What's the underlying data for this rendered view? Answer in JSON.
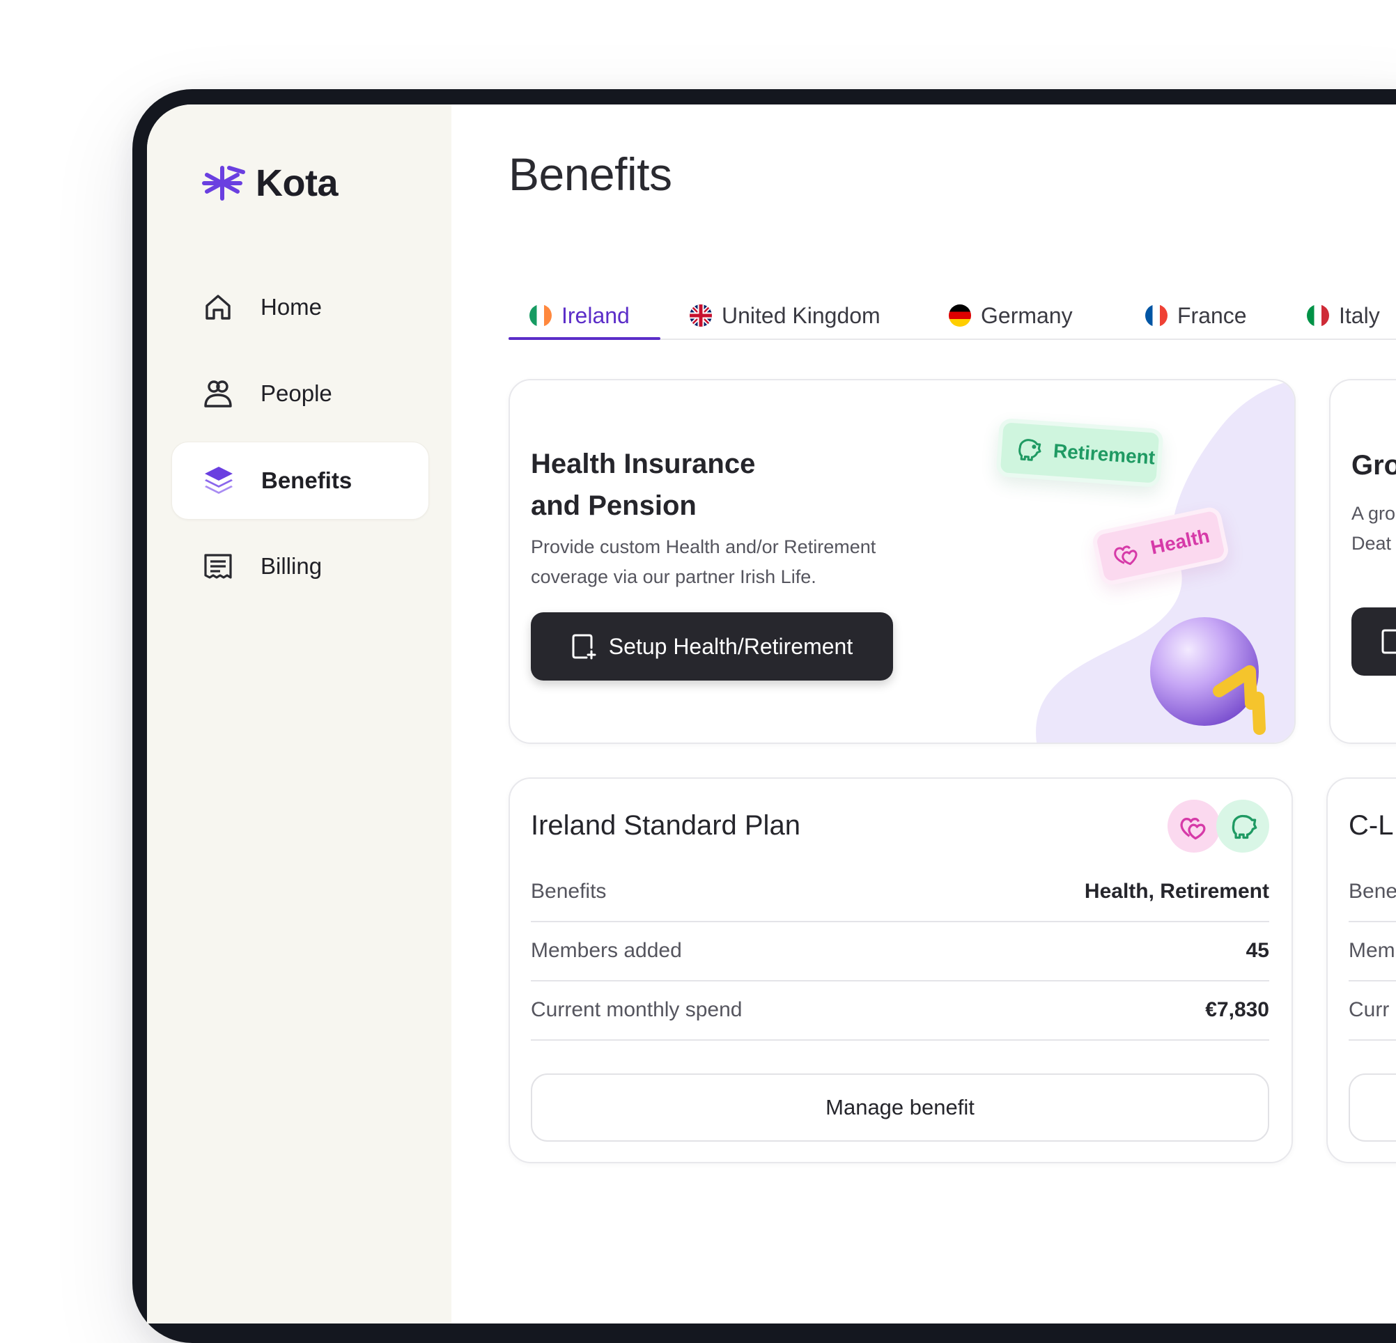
{
  "app": {
    "name": "Kota"
  },
  "nav": [
    {
      "label": "Home",
      "icon": "home-icon"
    },
    {
      "label": "People",
      "icon": "people-icon"
    },
    {
      "label": "Benefits",
      "icon": "layers-icon",
      "active": true
    },
    {
      "label": "Billing",
      "icon": "receipt-icon"
    }
  ],
  "page": {
    "title": "Benefits"
  },
  "tabs": [
    {
      "label": "Ireland",
      "active": true
    },
    {
      "label": "United Kingdom"
    },
    {
      "label": "Germany"
    },
    {
      "label": "France"
    },
    {
      "label": "Italy"
    }
  ],
  "promo": {
    "title_line1": "Health Insurance",
    "title_line2": "and Pension",
    "desc_line1": "Provide custom Health and/or Retirement",
    "desc_line2": "coverage via our partner Irish Life.",
    "button": "Setup Health/Retirement",
    "chip_retirement": "Retirement",
    "chip_health": "Health"
  },
  "promo2": {
    "title": "Gro",
    "desc_line1": "A gro",
    "desc_line2": "Deat"
  },
  "plan": {
    "title": "Ireland Standard Plan",
    "rows": [
      {
        "key": "Benefits",
        "value": "Health, Retirement"
      },
      {
        "key": "Members added",
        "value": "45"
      },
      {
        "key": "Current monthly spend",
        "value": "€7,830"
      }
    ],
    "button": "Manage benefit"
  },
  "plan2": {
    "title": "C-L",
    "rows": [
      "Bene",
      "Mem",
      "Curr"
    ]
  },
  "colors": {
    "accent": "#5b2dc8",
    "sidebar_bg": "#f7f6f0",
    "retirement_green": "#1f9a63",
    "health_pink": "#d63aa8"
  }
}
